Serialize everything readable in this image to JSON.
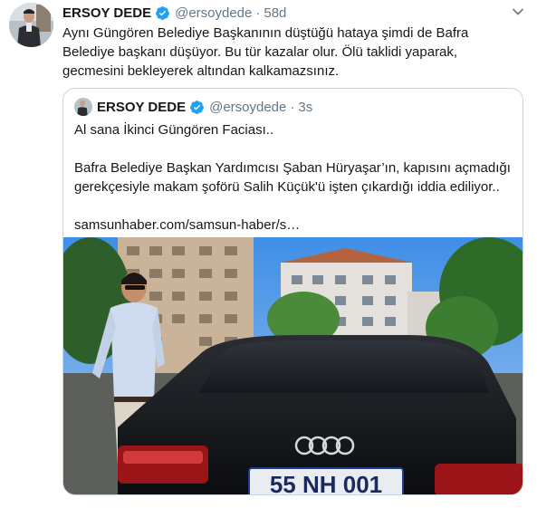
{
  "tweet": {
    "author_name": "ERSOY DEDE",
    "handle": "@ersoydede",
    "separator": "·",
    "time": "58d",
    "text_lines": [
      "Aynı Güngören Belediye Başkanının düştüğü hataya şimdi de Bafra",
      "Belediye başkanı düşüyor. Bu tür kazalar olur. Ölü taklidi yaparak,",
      "gecmesini bekleyerek altından kalkamazsınız."
    ]
  },
  "quoted": {
    "author_name": "ERSOY DEDE",
    "handle": "@ersoydede",
    "separator": "·",
    "time": "3s",
    "line1": "Al sana İkinci Güngören Faciası..",
    "line2": "Bafra Belediye Başkan Yardımcısı Şaban Hüryaşar’ın, kapısını açmadığı",
    "line3": "gerekçesiyle makam şoförü Salih Küçük'ü işten çıkardığı iddia ediliyor..",
    "link": "samsunhaber.com/samsun-haber/s…",
    "photo_plate": "55 NH 001"
  },
  "icons": {
    "verified": "verified-badge-icon",
    "caret": "chevron-down-icon"
  },
  "colors": {
    "text": "#14171a",
    "secondary": "#657786",
    "verified": "#1da1f2",
    "border": "#ccd6dd"
  }
}
